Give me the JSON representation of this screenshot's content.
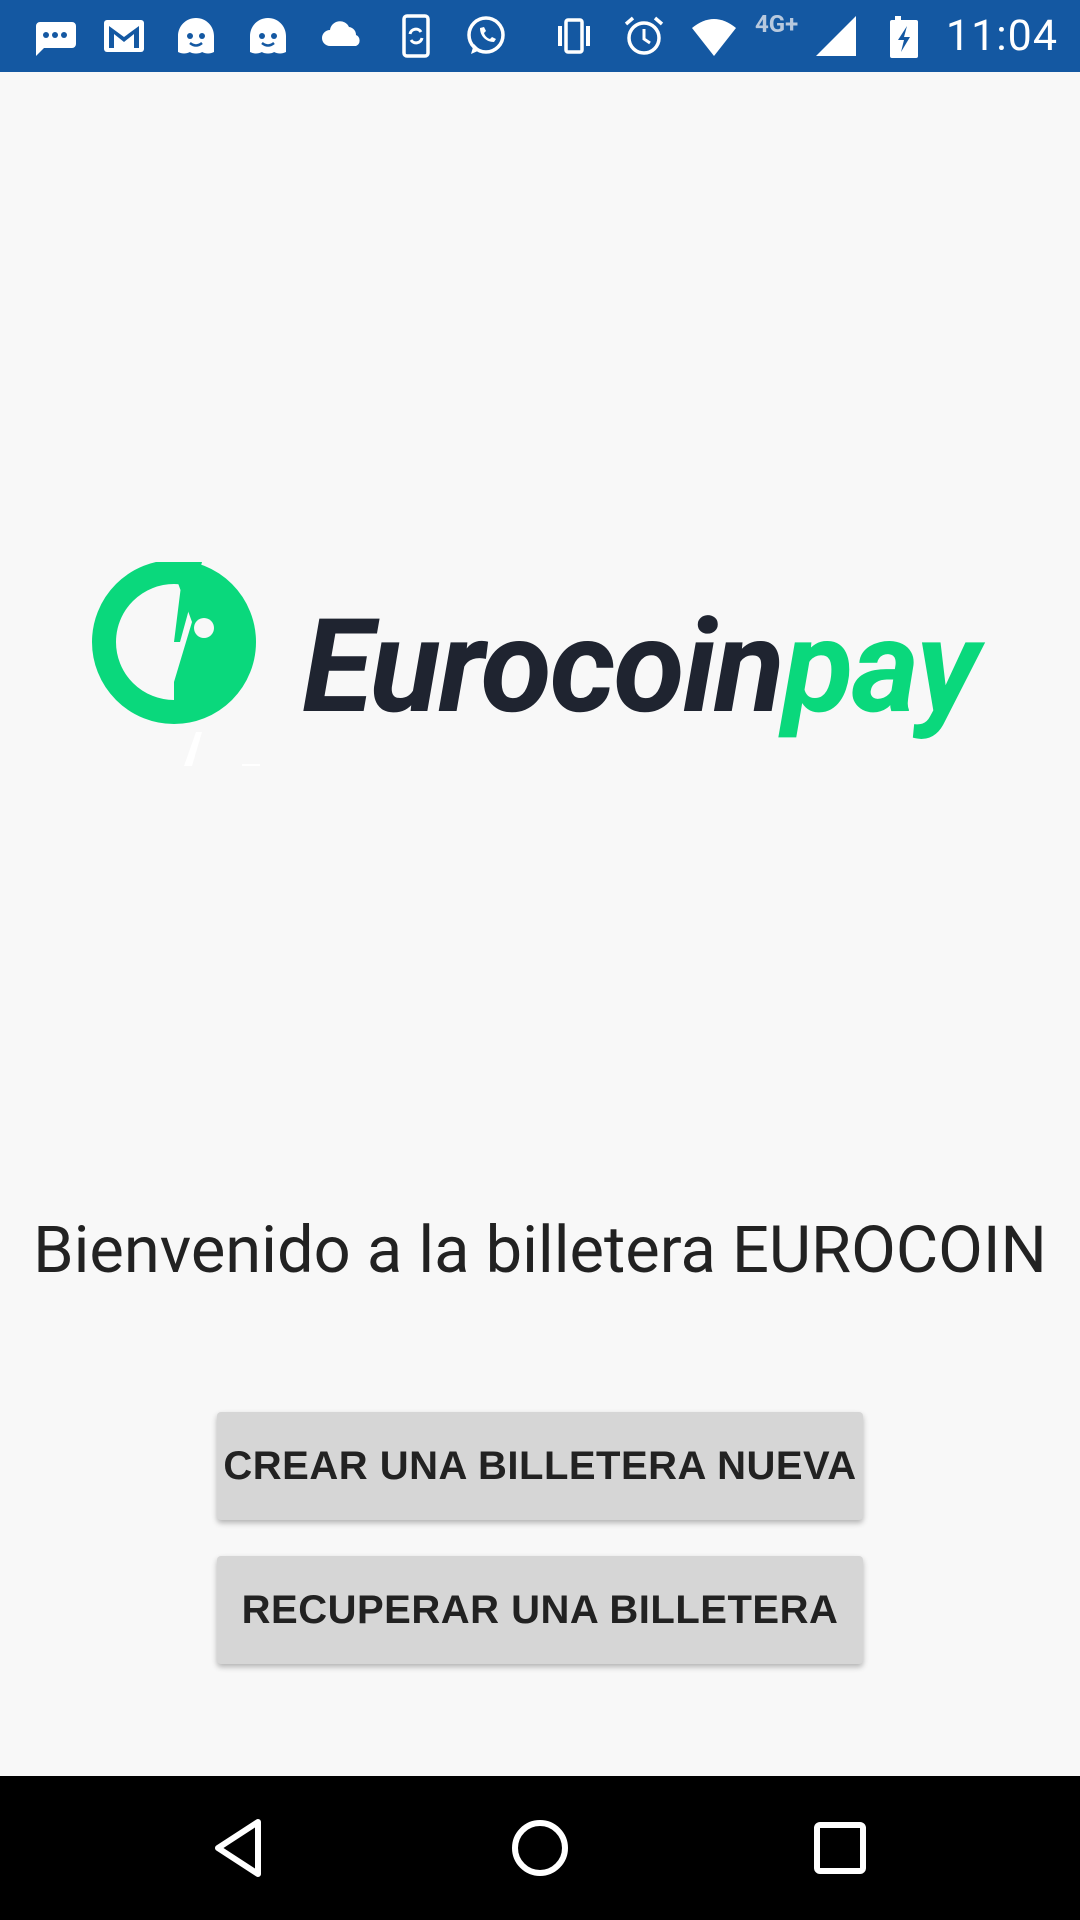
{
  "status_bar": {
    "time": "11:04",
    "network": "4G+",
    "icons": [
      "messages-icon",
      "gmail-icon",
      "app-ghost-icon",
      "app-ghost-icon",
      "cloud-icon",
      "sync-phone-icon",
      "whatsapp-icon",
      "vibrate-icon",
      "alarm-icon",
      "wifi-icon",
      "cell-signal-icon",
      "battery-charging-icon"
    ],
    "background_color": "#1458a2"
  },
  "logo": {
    "brand_dark": "Eurocoin",
    "brand_green": "pay",
    "colors": {
      "dark": "#1f2430",
      "green": "#0ad87c"
    }
  },
  "welcome": {
    "text": "Bienvenido a la billetera EUROCOIN"
  },
  "buttons": {
    "create": "CREAR UNA BILLETERA NUEVA",
    "recover": "RECUPERAR UNA BILLETERA"
  },
  "nav_bar": {
    "icons": [
      "back-icon",
      "home-icon",
      "recents-icon"
    ]
  }
}
